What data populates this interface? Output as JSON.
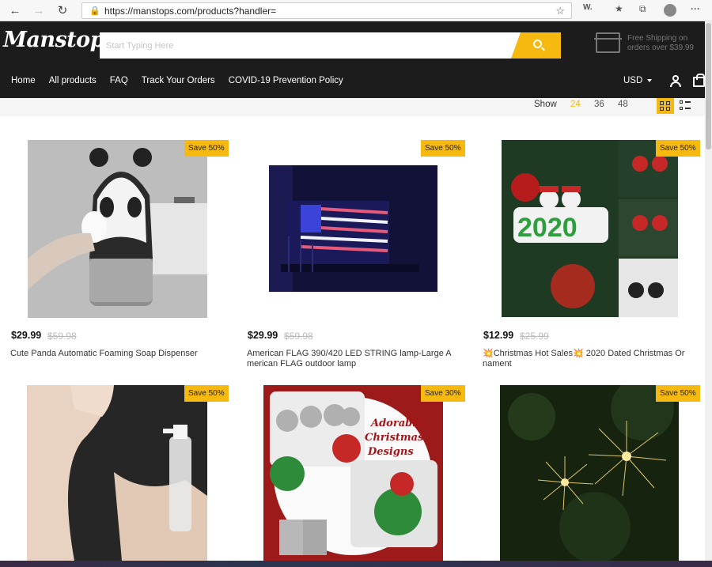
{
  "browser": {
    "url": "https://manstops.com/products?handler="
  },
  "header": {
    "logo": "Manstops",
    "search_placeholder": "Start Typing Here",
    "shipping_line1": "Free Shipping on",
    "shipping_line2": "orders over $39.99",
    "currency": "USD"
  },
  "menu": [
    "Home",
    "All products",
    "FAQ",
    "Track Your Orders",
    "COVID-19 Prevention Policy"
  ],
  "toolbar": {
    "show_label": "Show",
    "options": [
      "24",
      "36",
      "48"
    ],
    "active_option": "24"
  },
  "products": [
    {
      "badge": "Save 50%",
      "price": "$29.99",
      "old_price": "$59.98",
      "title_line1": "Cute Panda Automatic Foaming Soap Dispenser",
      "title_line2": ""
    },
    {
      "badge": "Save 50%",
      "price": "$29.99",
      "old_price": "$59.98",
      "title_line1": "American FLAG 390/420 LED STRING lamp-Large A",
      "title_line2": "merican FLAG outdoor lamp"
    },
    {
      "badge": "Save 50%",
      "price": "$12.99",
      "old_price": "$25.99",
      "title_line1": "💥Christmas Hot Sales💥 2020 Dated Christmas Or",
      "title_line2": "nament"
    },
    {
      "badge": "Save 50%"
    },
    {
      "badge": "Save 30%",
      "img_text_line1": "Adorable",
      "img_text_line2": "Christmas",
      "img_text_line3": "Designs"
    },
    {
      "badge": "Save 50%"
    }
  ],
  "colors": {
    "accent": "#f5b90f",
    "header_bg": "#1c1c1c"
  }
}
